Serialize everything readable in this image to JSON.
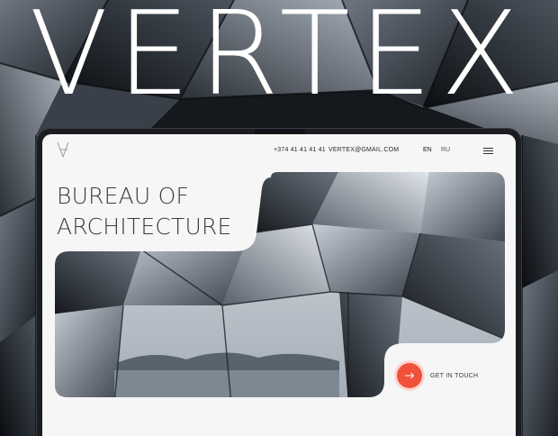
{
  "hero_banner": {
    "title": "VERTEX"
  },
  "site": {
    "header": {
      "phone": "+374 41 41 41 41",
      "email": "VERTEX@GMAIL.COM",
      "languages": [
        "EN",
        "RU"
      ]
    },
    "headline_line1": "BUREAU OF",
    "headline_line2": "ARCHITECTURE",
    "cta_label": "GET IN TOUCH"
  },
  "colors": {
    "accent": "#f0513b",
    "screen_bg": "#f6f6f6",
    "outer_bg": "#0c0e12"
  },
  "icons": {
    "logo": "vertex-logo-icon",
    "menu": "hamburger-menu-icon",
    "cta": "arrow-right-icon"
  }
}
